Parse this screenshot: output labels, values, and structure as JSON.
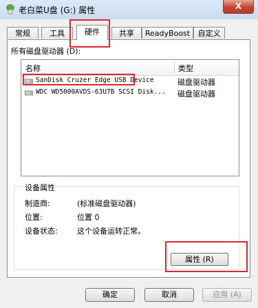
{
  "window": {
    "title": "老白菜U盘 (G:) 属性",
    "close_label": "X"
  },
  "tabs": [
    {
      "label": "常规"
    },
    {
      "label": "工具"
    },
    {
      "label": "硬件",
      "active": true
    },
    {
      "label": "共享"
    },
    {
      "label": "ReadyBoost"
    },
    {
      "label": "自定义"
    }
  ],
  "devices": {
    "label": "所有磁盘驱动器 (D):",
    "columns": [
      "名称",
      "类型"
    ],
    "rows": [
      {
        "name": "SanDisk Cruzer Edge USB Device",
        "type": "磁盘驱动器"
      },
      {
        "name": "WDC WD5000AVDS-63U7B SCSI Disk...",
        "type": "磁盘驱动器"
      }
    ]
  },
  "device_properties": {
    "title": "设备属性",
    "manufacturer_label": "制造商:",
    "manufacturer_value": "(标准磁盘驱动器)",
    "location_label": "位置:",
    "location_value": "位置 0",
    "status_label": "设备状态:",
    "status_value": "这个设备运转正常。",
    "properties_button": "属性 (R)"
  },
  "buttons": {
    "ok": "确定",
    "cancel": "取消",
    "apply": "应用 (A)"
  },
  "colors": {
    "highlight": "#e0262e"
  }
}
